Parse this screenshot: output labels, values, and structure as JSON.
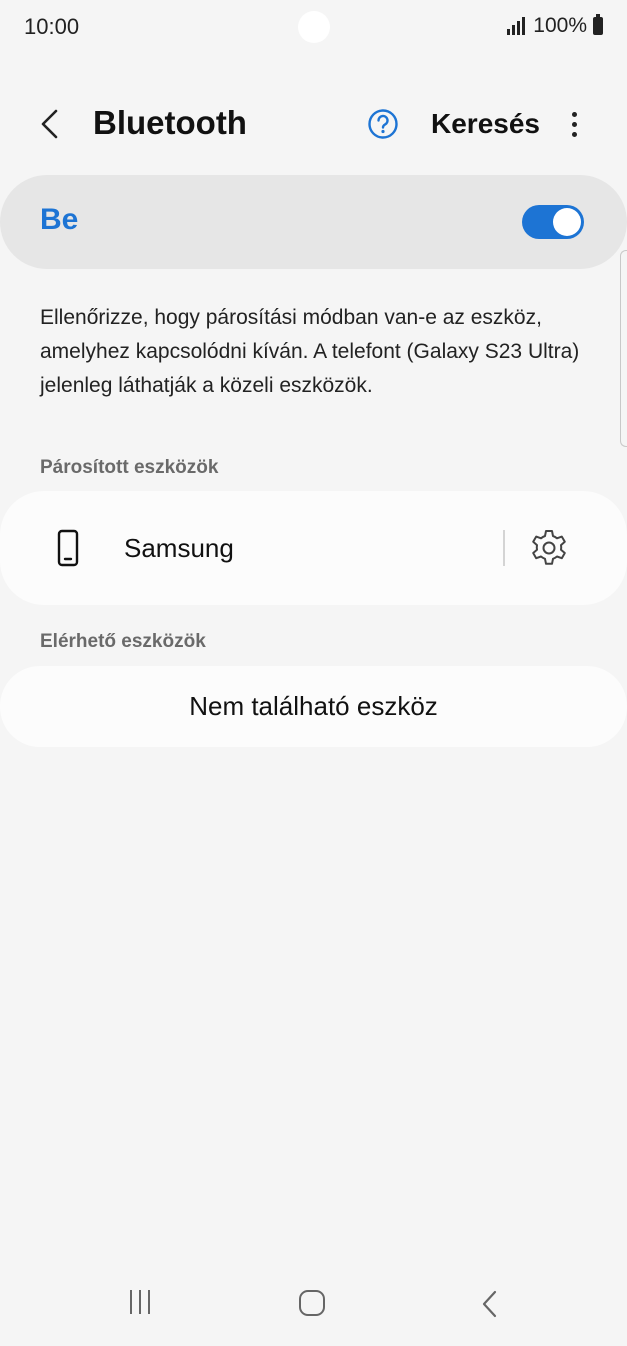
{
  "status_bar": {
    "time": "10:00",
    "battery": "100%"
  },
  "app_bar": {
    "title": "Bluetooth",
    "search_label": "Keresés",
    "back_icon": "chevron-left-icon",
    "help_icon": "question-circle-icon",
    "more_icon": "more-vertical-icon"
  },
  "bluetooth_toggle": {
    "label": "Be",
    "state": "on",
    "accent_color": "#1d74d4"
  },
  "description": "Ellenőrizze, hogy párosítási módban van-e az eszköz, amelyhez kapcsolódni kíván. A telefont (Galaxy S23 Ultra) jelenleg láthatják a közeli eszközök.",
  "paired_devices": {
    "header": "Párosított eszközök",
    "items": [
      {
        "name": "Samsung",
        "icon": "phone-icon",
        "settings_icon": "gear-icon"
      }
    ]
  },
  "available_devices": {
    "header": "Elérhető eszközök",
    "empty_message": "Nem található eszköz"
  },
  "nav_bar": {
    "recents_icon": "recents-icon",
    "home_icon": "home-icon",
    "back_icon": "back-icon"
  }
}
